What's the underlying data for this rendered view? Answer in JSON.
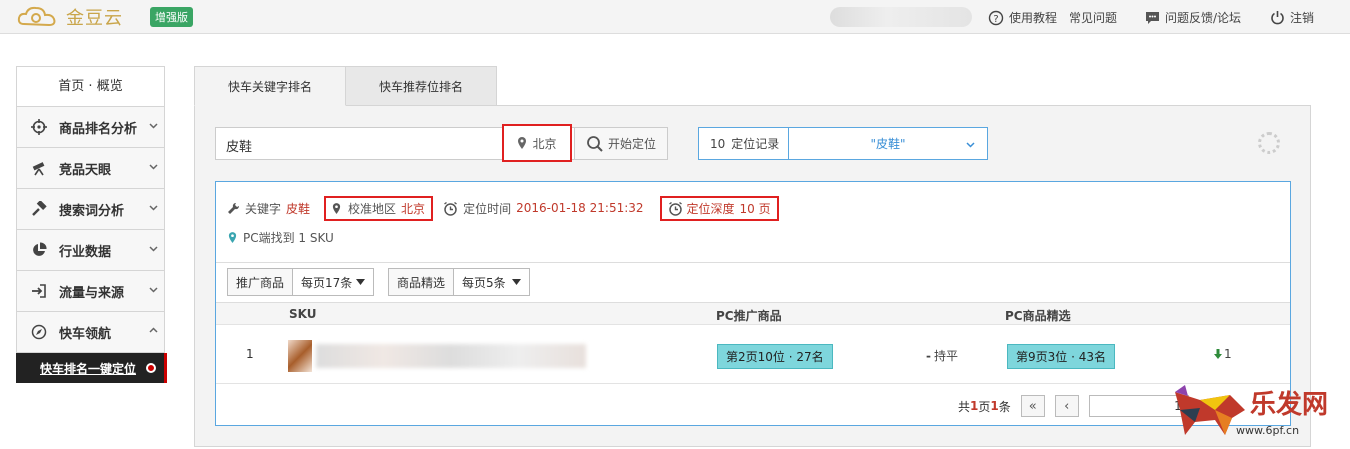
{
  "header": {
    "brand": "金豆云",
    "edition": "增强版",
    "links": [
      {
        "label": "使用教程",
        "icon": "help-circle-icon"
      },
      {
        "label": "常见问题"
      },
      {
        "label": "问题反馈/论坛",
        "icon": "chat-icon"
      },
      {
        "label": "注销",
        "icon": "power-icon"
      }
    ]
  },
  "sidebar": {
    "home": "首页 · 概览",
    "items": [
      {
        "label": "商品排名分析",
        "icon": "crosshair-icon"
      },
      {
        "label": "竞品天眼",
        "icon": "telescope-icon"
      },
      {
        "label": "搜索词分析",
        "icon": "hammer-icon"
      },
      {
        "label": "行业数据",
        "icon": "pie-chart-icon"
      },
      {
        "label": "流量与来源",
        "icon": "sign-in-icon"
      },
      {
        "label": "快车领航",
        "icon": "compass-icon"
      }
    ],
    "active_sub": "快车排名一键定位"
  },
  "tabs": [
    "快车关键字排名",
    "快车推荐位排名"
  ],
  "search": {
    "keyword": "皮鞋",
    "location": "北京",
    "locate_label": "开始定位",
    "record_count": "10",
    "record_label": "定位记录",
    "record_selected": "\"皮鞋\""
  },
  "result": {
    "keyword_label": "关键字",
    "keyword": "皮鞋",
    "region_label": "校准地区",
    "region": "北京",
    "time_label": "定位时间",
    "time": "2016-01-18 21:51:32",
    "depth_label": "定位深度",
    "depth": "10 页",
    "found": "PC端找到 1 SKU",
    "filter1_label": "推广商品",
    "filter1_value": "每页17条",
    "filter2_label": "商品精选",
    "filter2_value": "每页5条",
    "columns": [
      "SKU",
      "PC推广商品",
      "PC商品精选"
    ],
    "rows": [
      {
        "index": "1",
        "promo_rank": "第2页10位 · 27名",
        "trend": "持平",
        "select_rank": "第9页3位 · 43名",
        "change": "1"
      }
    ],
    "pager": {
      "prefix": "共",
      "pages": "1",
      "mid": "页",
      "items": "1",
      "suffix": "条",
      "first": "«",
      "prev": "‹",
      "current": "1"
    }
  },
  "watermark": {
    "text": "乐发网",
    "url": "www.6pf.cn"
  },
  "colors": {
    "accent": "#3a8fd6",
    "highlight": "#e02020",
    "tag": "#7ed6dc",
    "edition": "#3aa564"
  }
}
